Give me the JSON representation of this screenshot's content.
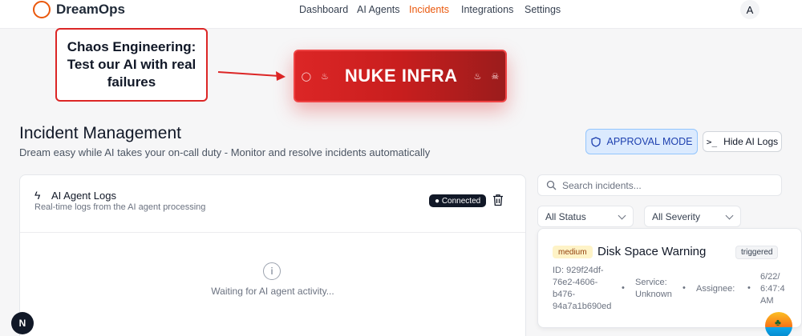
{
  "header": {
    "brand": "DreamOps",
    "nav": [
      {
        "label": "Dashboard",
        "active": false
      },
      {
        "label": "AI Agents",
        "active": false
      },
      {
        "label": "Incidents",
        "active": true
      },
      {
        "label": "Integrations",
        "active": false
      },
      {
        "label": "Settings",
        "active": false
      }
    ],
    "avatar_initial": "A",
    "accent_color": "#ea580c"
  },
  "callout": {
    "line1": "Chaos Engineering:",
    "line2": "Test our AI with real",
    "line3": "failures"
  },
  "nuke_button": {
    "label": "NUKE INFRA",
    "icons": [
      "bomb-icon",
      "fire-icon",
      "fire-icon",
      "skull-icon"
    ],
    "color": "#dc2626"
  },
  "page": {
    "title": "Incident Management",
    "subtitle": "Dream easy while AI takes your on-call duty - Monitor and resolve incidents automatically"
  },
  "actions": {
    "approval_mode": "APPROVAL MODE",
    "hide_logs": "Hide AI Logs"
  },
  "logs_panel": {
    "title": "AI Agent Logs",
    "subtitle": "Real-time logs from the AI agent processing",
    "status": "● Connected",
    "empty_text": "Waiting for AI agent activity..."
  },
  "filters": {
    "search_placeholder": "Search incidents...",
    "status": "All Status",
    "severity": "All Severity"
  },
  "incident": {
    "severity": "medium",
    "title": "Disk Space Warning",
    "status": "triggered",
    "id_lines": [
      "ID: 929f24df-",
      "76e2-4606-",
      "b476-",
      "94a7a1b690ed"
    ],
    "service_lines": [
      "Service:",
      "Unknown"
    ],
    "assignee": "Assignee:",
    "date_lines": [
      "6/22/",
      "6:47:4",
      "AM"
    ]
  },
  "overlays": {
    "n_badge": "N"
  }
}
